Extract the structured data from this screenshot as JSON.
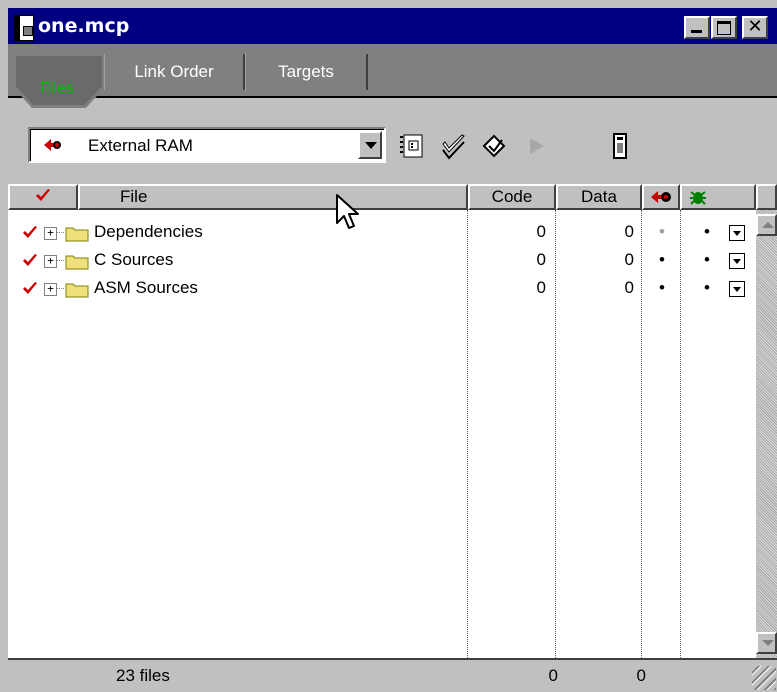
{
  "window": {
    "title": "one.mcp"
  },
  "tabs": [
    {
      "label": "Files",
      "active": true
    },
    {
      "label": "Link Order",
      "active": false
    },
    {
      "label": "Targets",
      "active": false
    }
  ],
  "toolbar": {
    "target_value": "External RAM",
    "icons": [
      "target-settings-icon",
      "check-syntax-icon",
      "compile-icon",
      "run-icon",
      "device-icon"
    ]
  },
  "columns": {
    "file": "File",
    "code": "Code",
    "data": "Data"
  },
  "rows": [
    {
      "name": "Dependencies",
      "code": "0",
      "data": "0",
      "dot1": "•",
      "dot2": "•",
      "dot1_color": "#a0a0a0"
    },
    {
      "name": "C Sources",
      "code": "0",
      "data": "0",
      "dot1": "•",
      "dot2": "•",
      "dot1_color": "#000000"
    },
    {
      "name": "ASM Sources",
      "code": "0",
      "data": "0",
      "dot1": "•",
      "dot2": "•",
      "dot1_color": "#000000"
    }
  ],
  "status": {
    "files": "23 files",
    "code_total": "0",
    "data_total": "0"
  },
  "colors": {
    "titlebar": "#000080",
    "check_red": "#cc0000",
    "active_tab_text": "#00c000",
    "folder": "#f0e07a"
  }
}
